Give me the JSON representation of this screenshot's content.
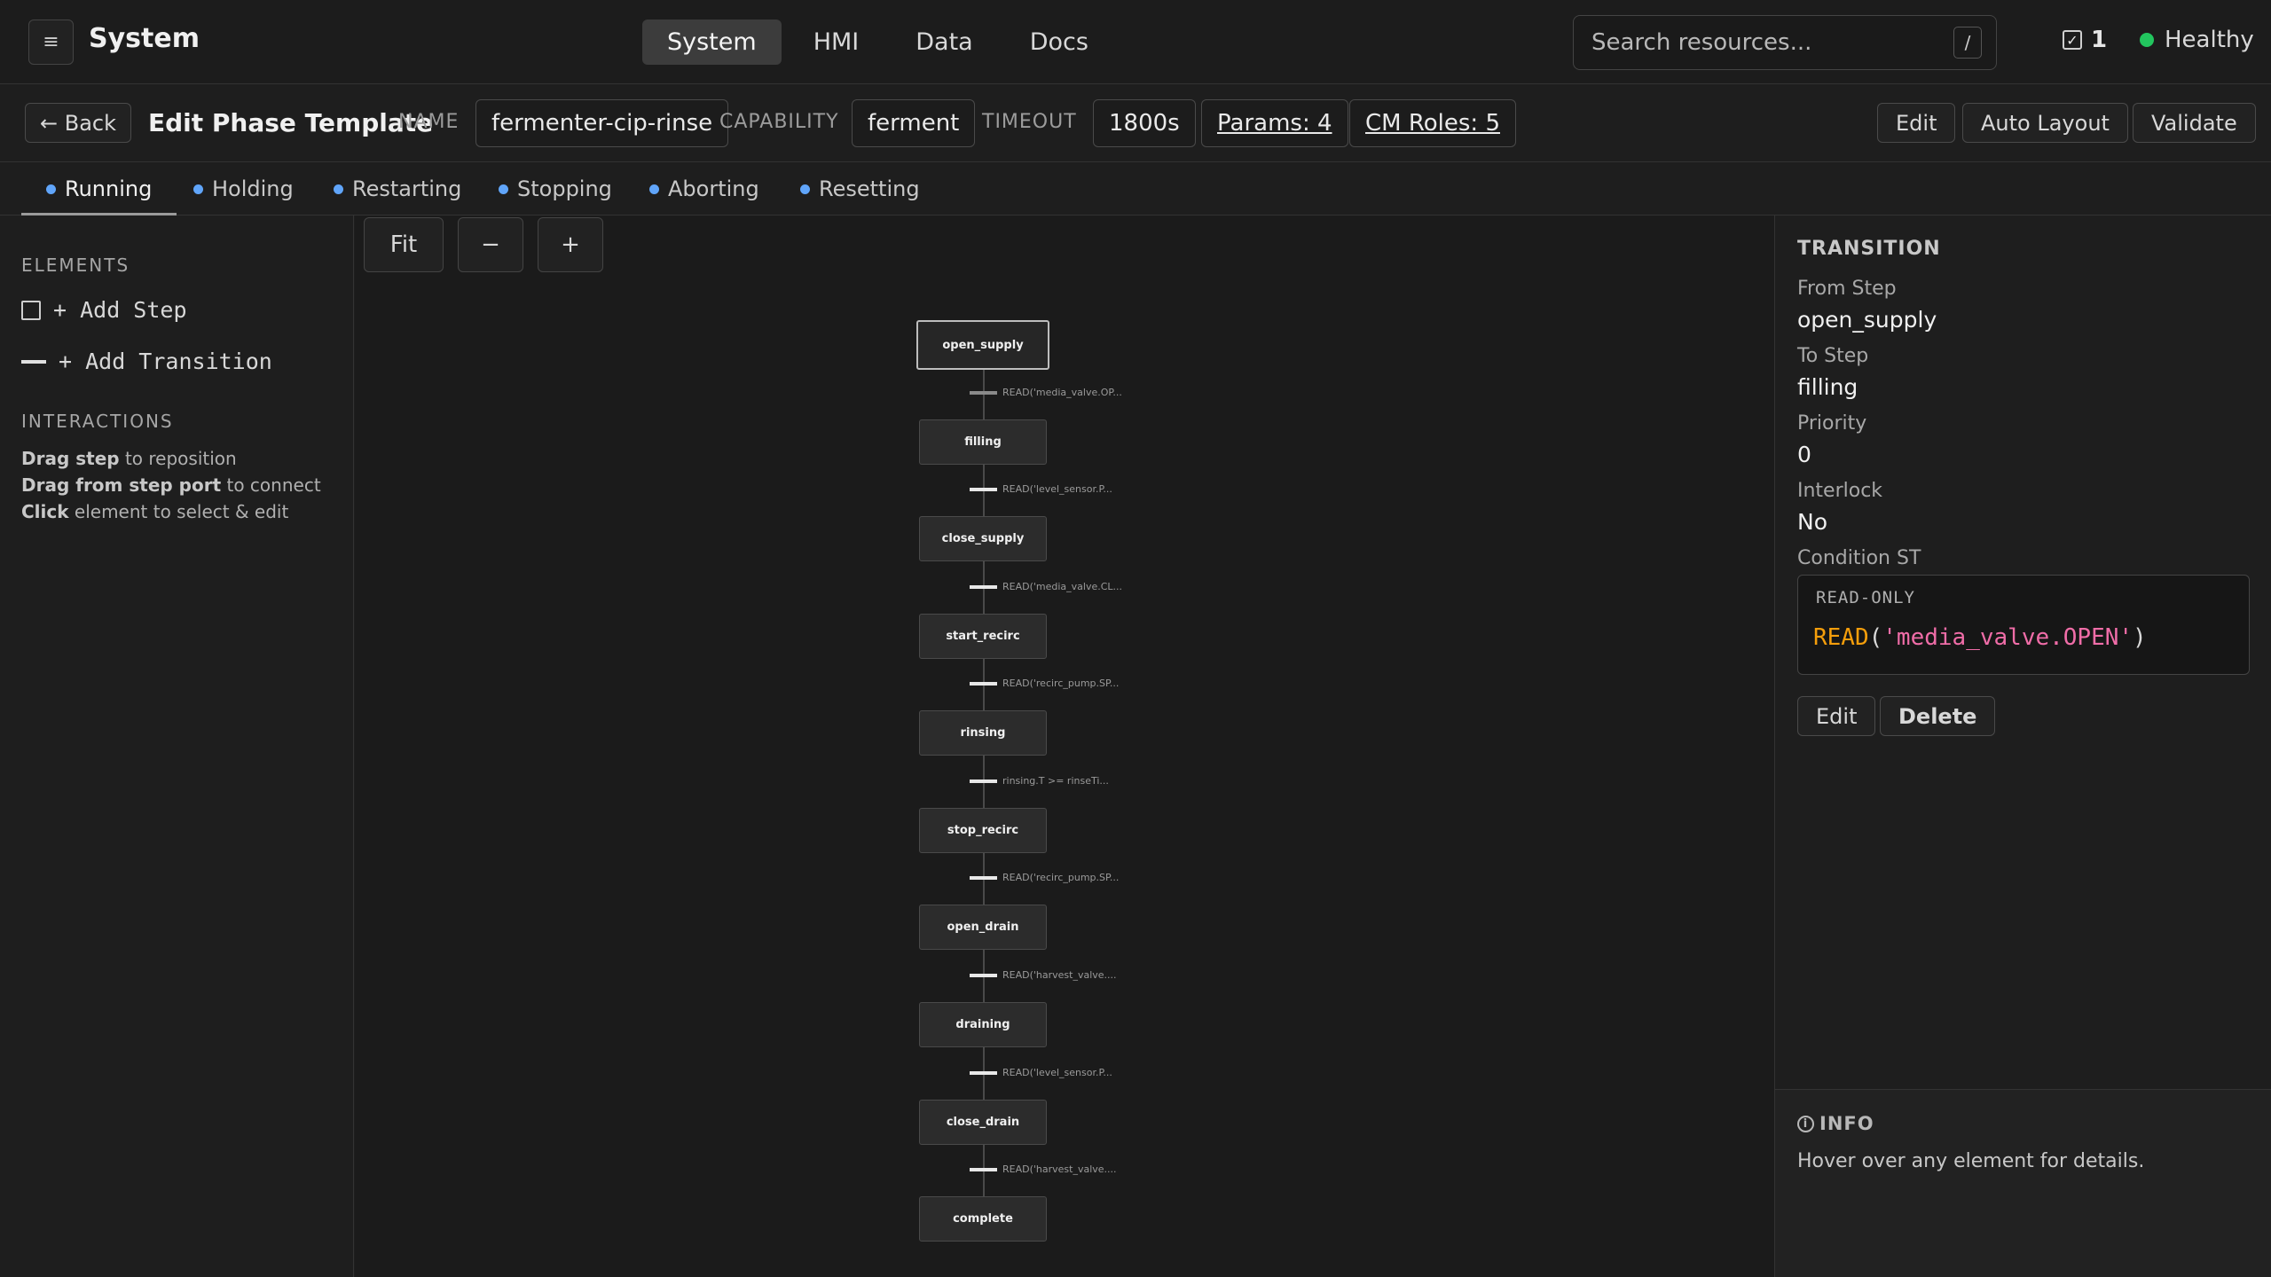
{
  "header": {
    "menu_icon": "≡",
    "app_title": "System",
    "nav_tabs": [
      "System",
      "HMI",
      "Data",
      "Docs"
    ],
    "active_nav": "System",
    "search_placeholder": "Search resources...",
    "search_shortcut": "/",
    "task_count": "1",
    "health_status": "Healthy",
    "health_color": "#22c55e"
  },
  "editbar": {
    "back_label": "← Back",
    "title": "Edit Phase Template",
    "name_label": "NAME",
    "name_value": "fermenter-cip-rinse",
    "capability_label": "CAPABILITY",
    "capability_value": "ferment",
    "timeout_label": "TIMEOUT",
    "timeout_value": "1800s",
    "params_label": "Params: 4",
    "cm_roles_label": "CM Roles: 5",
    "edit_label": "Edit",
    "auto_layout_label": "Auto Layout",
    "validate_label": "Validate"
  },
  "phase_tabs": [
    "Running",
    "Holding",
    "Restarting",
    "Stopping",
    "Aborting",
    "Resetting"
  ],
  "active_phase": "Running",
  "phase_dot_color": "#60a5fa",
  "left_panel": {
    "elements_title": "ELEMENTS",
    "add_step": "+ Add Step",
    "add_transition": "+ Add Transition",
    "interactions_title": "INTERACTIONS",
    "hints": [
      {
        "bold": "Drag step",
        "rest": " to reposition"
      },
      {
        "bold": "Drag from step port",
        "rest": " to connect"
      },
      {
        "bold": "Click",
        "rest": " element to select & edit"
      }
    ]
  },
  "canvas": {
    "zoom_fit": "Fit",
    "zoom_out": "−",
    "zoom_in": "+",
    "steps": [
      "open_supply",
      "filling",
      "close_supply",
      "start_recirc",
      "rinsing",
      "stop_recirc",
      "open_drain",
      "draining",
      "close_drain",
      "complete"
    ],
    "selected_step": "open_supply",
    "transitions": [
      "READ('media_valve.OP...",
      "READ('level_sensor.P...",
      "READ('media_valve.CL...",
      "READ('recirc_pump.SP...",
      "rinsing.T >= rinseTi...",
      "READ('recirc_pump.SP...",
      "READ('harvest_valve....",
      "READ('level_sensor.P...",
      "READ('harvest_valve...."
    ]
  },
  "right_panel": {
    "title": "TRANSITION",
    "from_step_label": "From Step",
    "from_step": "open_supply",
    "to_step_label": "To Step",
    "to_step": "filling",
    "priority_label": "Priority",
    "priority": "0",
    "interlock_label": "Interlock",
    "interlock": "No",
    "condition_label": "Condition ST",
    "read_only": "READ-ONLY",
    "code_fn": "READ",
    "code_open": "(",
    "code_str": "'media_valve.OPEN'",
    "code_close": ")",
    "edit_label": "Edit",
    "delete_label": "Delete",
    "info_title": "INFO",
    "info_text": "Hover over any element for details."
  }
}
